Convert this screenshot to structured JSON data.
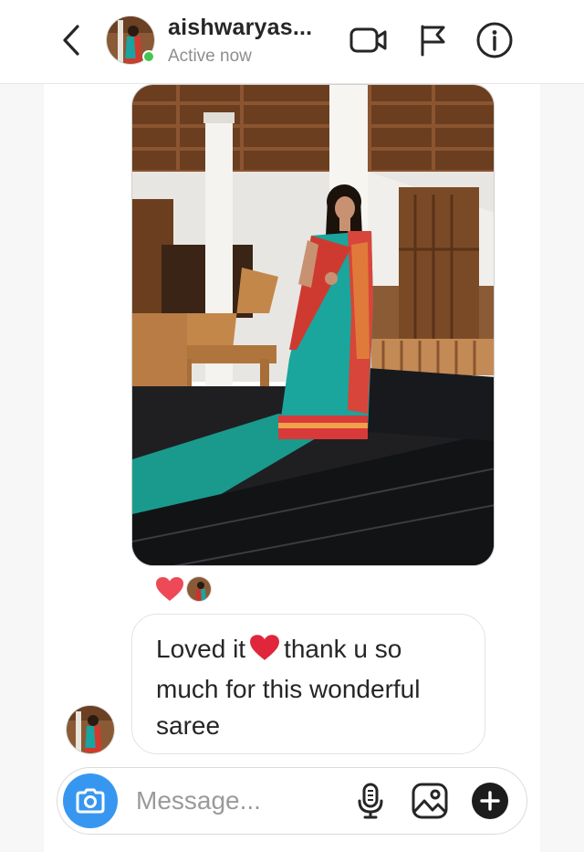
{
  "header": {
    "username": "aishwaryas...",
    "status": "Active now",
    "back_icon": "chevron-left-icon",
    "video_icon": "video-camera-icon",
    "flag_icon": "flag-icon",
    "info_icon": "info-icon"
  },
  "thread": {
    "photo_icon": "shared-photo",
    "reaction_icon": "red-heart-icon",
    "message_before_emoji": "Loved it",
    "message_after_emoji": "thank u so much for this wonderful saree",
    "emoji_icon": "red-heart-icon"
  },
  "composer": {
    "placeholder": "Message...",
    "camera_icon": "camera-icon",
    "mic_icon": "microphone-icon",
    "gallery_icon": "image-icon",
    "plus_icon": "plus-circle-icon"
  },
  "colors": {
    "accent": "#3797f0",
    "online": "#44c553",
    "heart": "#ed4956",
    "text": "#262626",
    "muted": "#8e8e8e"
  }
}
